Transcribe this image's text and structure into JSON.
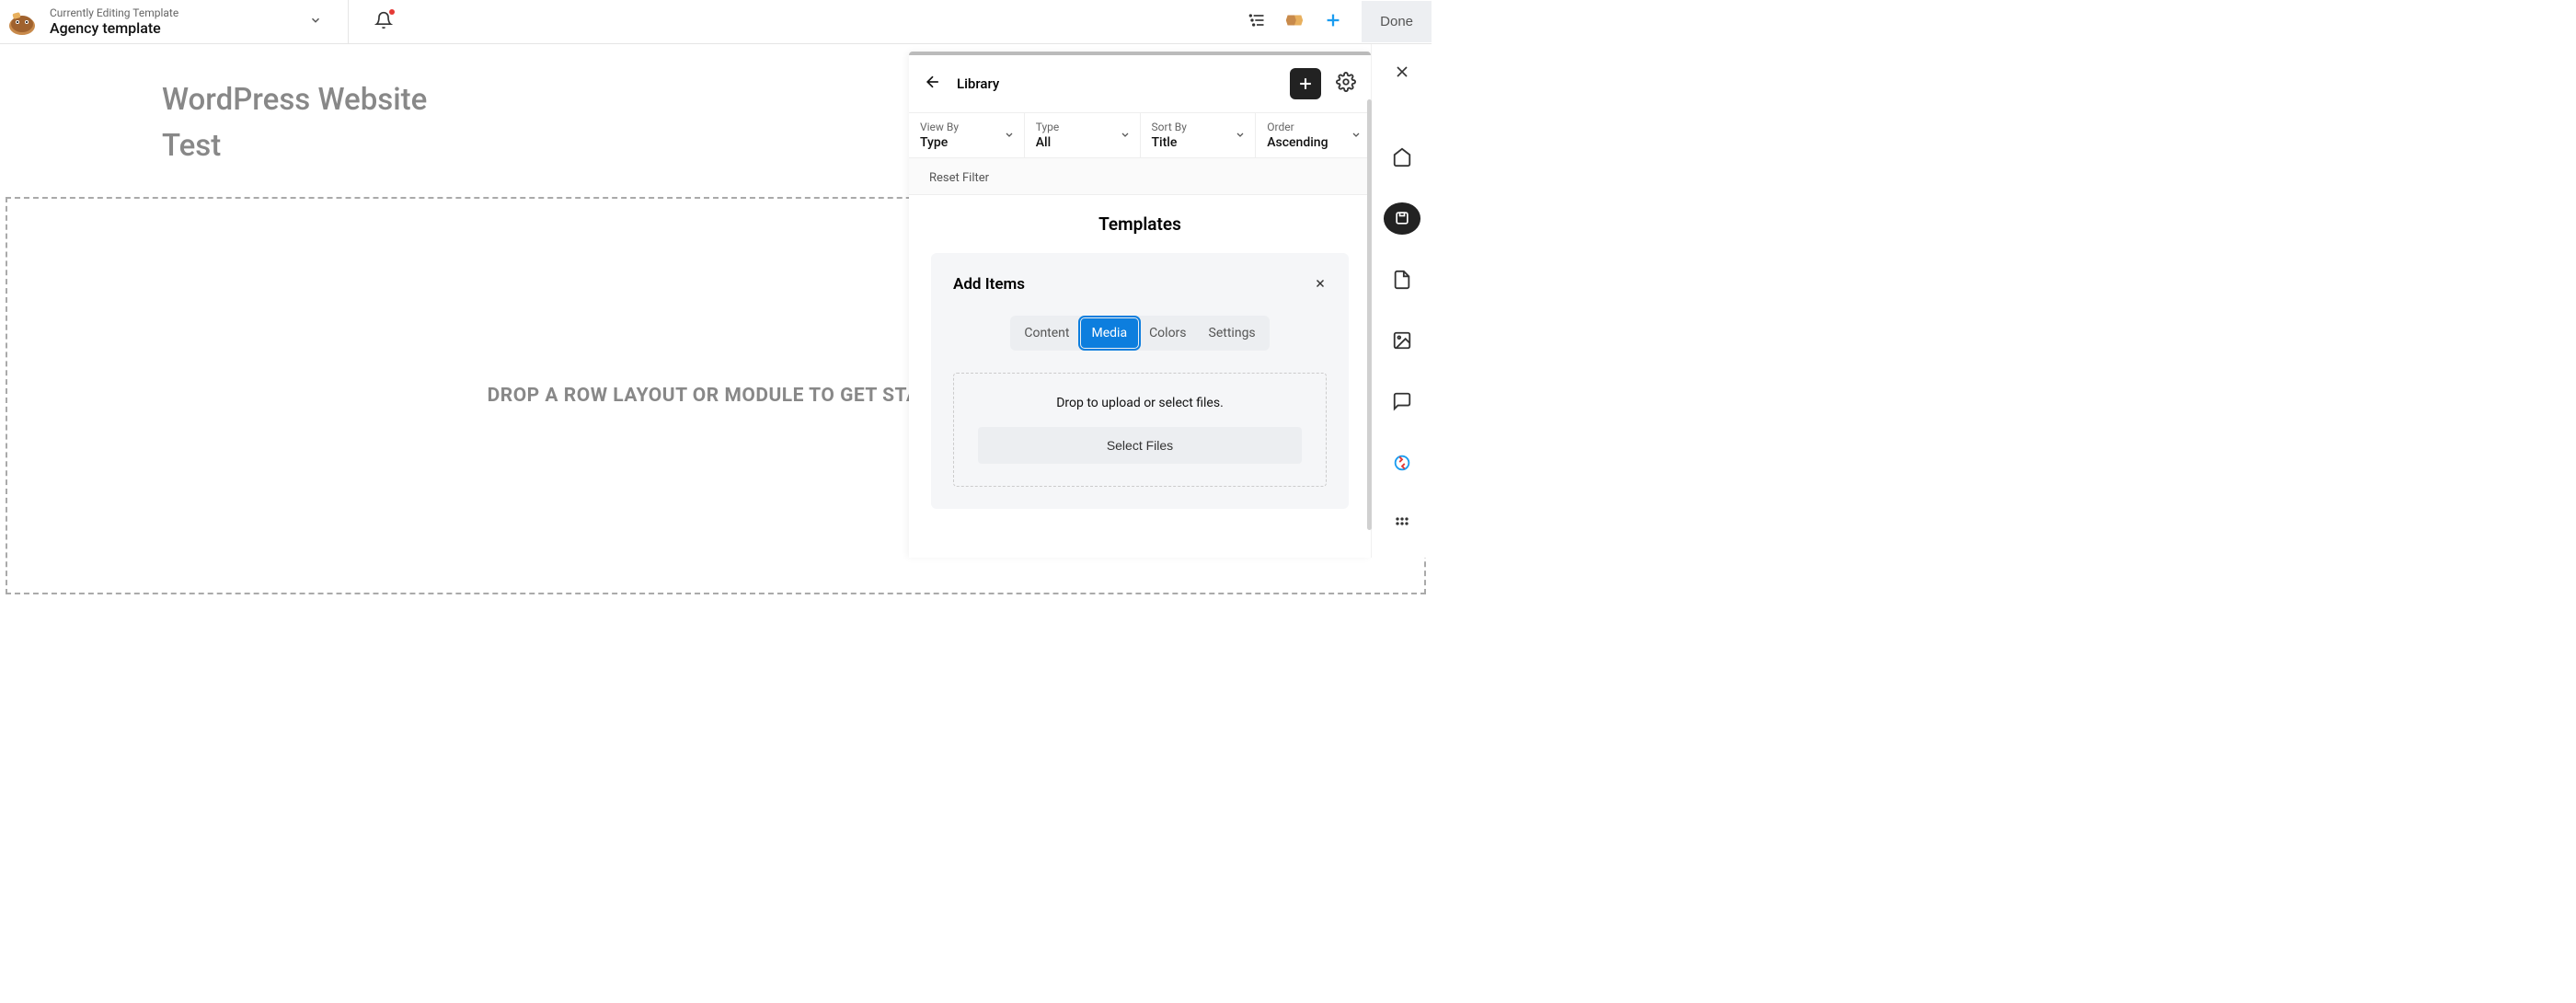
{
  "header": {
    "editing_label": "Currently Editing Template",
    "template_name": "Agency template",
    "done_label": "Done"
  },
  "canvas": {
    "title_line1": "WordPress Website",
    "title_line2": "Test",
    "drop_hint": "DROP A ROW LAYOUT OR MODULE TO GET START"
  },
  "panel": {
    "title": "Library",
    "filters": {
      "viewby": {
        "label": "View By",
        "value": "Type"
      },
      "type": {
        "label": "Type",
        "value": "All"
      },
      "sortby": {
        "label": "Sort By",
        "value": "Title"
      },
      "order": {
        "label": "Order",
        "value": "Ascending"
      }
    },
    "reset_label": "Reset Filter",
    "section_title": "Templates",
    "add_card": {
      "title": "Add Items",
      "tabs": [
        "Content",
        "Media",
        "Colors",
        "Settings"
      ],
      "active_tab": "Media",
      "upload_text": "Drop to upload or select files.",
      "select_btn": "Select Files"
    }
  }
}
